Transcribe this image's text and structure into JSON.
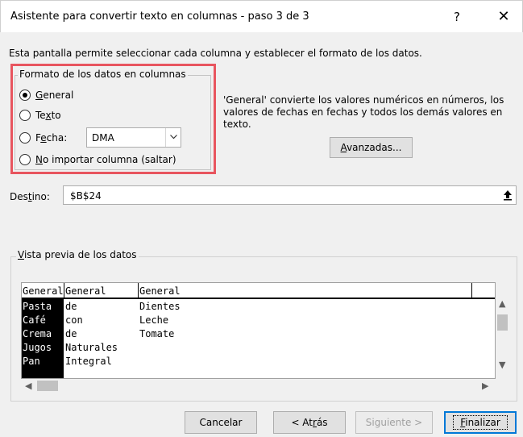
{
  "window": {
    "title": "Asistente para convertir texto en columnas - paso 3 de 3",
    "help_label": "?",
    "close_label": "✕"
  },
  "description": "Esta pantalla permite seleccionar cada columna y establecer el formato de los datos.",
  "format": {
    "legend": "Formato de los datos en columnas",
    "options": [
      {
        "pre": "",
        "u": "G",
        "post": "eneral",
        "checked": true
      },
      {
        "pre": "Te",
        "u": "x",
        "post": "to",
        "checked": false
      },
      {
        "pre": "F",
        "u": "e",
        "post": "cha:",
        "checked": false
      },
      {
        "pre": "",
        "u": "N",
        "post": "o importar columna (saltar)",
        "checked": false
      }
    ],
    "date_format": "DMA"
  },
  "info_text": "'General' convierte los valores numéricos en números, los valores de fechas en fechas y todos los demás valores en texto.",
  "advanced": {
    "u": "A",
    "post": "vanzadas..."
  },
  "destination": {
    "label_pre": "Des",
    "label_u": "t",
    "label_post": "ino:",
    "value": "$B$24"
  },
  "preview": {
    "legend_u": "V",
    "legend_post": "ista previa de los datos",
    "headers": [
      "General",
      "General",
      "General"
    ],
    "rows": [
      [
        "Pasta",
        "de",
        "Dientes"
      ],
      [
        "Café",
        "con",
        "Leche"
      ],
      [
        "Crema",
        "de",
        "Tomate"
      ],
      [
        "Jugos",
        "Naturales",
        ""
      ],
      [
        "Pan",
        "Integral",
        ""
      ]
    ]
  },
  "buttons": {
    "cancel": "Cancelar",
    "back_pre": "< At",
    "back_u": "r",
    "back_post": "ás",
    "next": "Siguiente >",
    "finish_u": "F",
    "finish_post": "inalizar"
  },
  "colors": {
    "highlight": "#e8555f",
    "focus": "#0078d7"
  }
}
